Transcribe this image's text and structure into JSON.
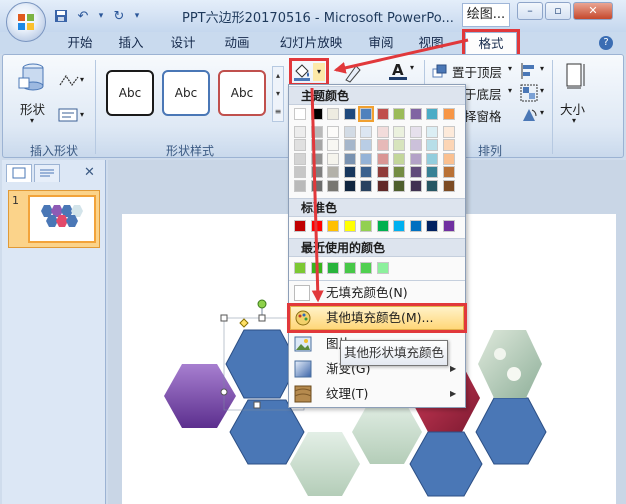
{
  "window": {
    "title": "PPT六边形20170516 - Microsoft PowerPo...",
    "context_tab_group": "绘图...",
    "minimize": "–",
    "restore": "▫",
    "close": "✕"
  },
  "tabs": [
    "开始",
    "插入",
    "设计",
    "动画",
    "幻灯片放映",
    "审阅",
    "视图",
    "格式"
  ],
  "ribbon": {
    "insert_shape": {
      "button_label": "形状",
      "group_label": "插入形状"
    },
    "shape_styles": {
      "samples": [
        "Abc",
        "Abc",
        "Abc"
      ],
      "group_label": "形状样式"
    },
    "arrange": {
      "bring_to_front": "置于顶层",
      "send_to_back": "于底层",
      "selection_pane": "择窗格",
      "group_label": "排列"
    },
    "size": {
      "button_label": "大小"
    }
  },
  "fill_menu": {
    "theme_colors_header": "主题颜色",
    "standard_colors_header": "标准色",
    "recent_colors_header": "最近使用的颜色",
    "no_fill": "无填充颜色(N)",
    "more_fill_colors": "其他填充颜色(M)...",
    "picture": "图片",
    "gradient": "渐变(G)",
    "texture": "纹理(T)"
  },
  "tooltip": "其他形状填充颜色",
  "slides_pane": {
    "slide_number": "1"
  },
  "colors": {
    "accent_red": "#e1383b",
    "hexagon_blue": "#4a77b6",
    "theme_top": [
      "#ffffff",
      "#000000",
      "#eeece1",
      "#1f497d",
      "#4f81bd",
      "#c0504d",
      "#9bbb59",
      "#8064a2",
      "#4bacc6",
      "#f79646"
    ],
    "standard": [
      "#c00000",
      "#ff0000",
      "#ffc000",
      "#ffff00",
      "#92d050",
      "#00b050",
      "#00b0f0",
      "#0070c0",
      "#002060",
      "#7030a0"
    ],
    "recent": [
      "#7cc832",
      "#38b41c",
      "#28b43c",
      "#48c848",
      "#50d050",
      "#8cf09c"
    ]
  }
}
